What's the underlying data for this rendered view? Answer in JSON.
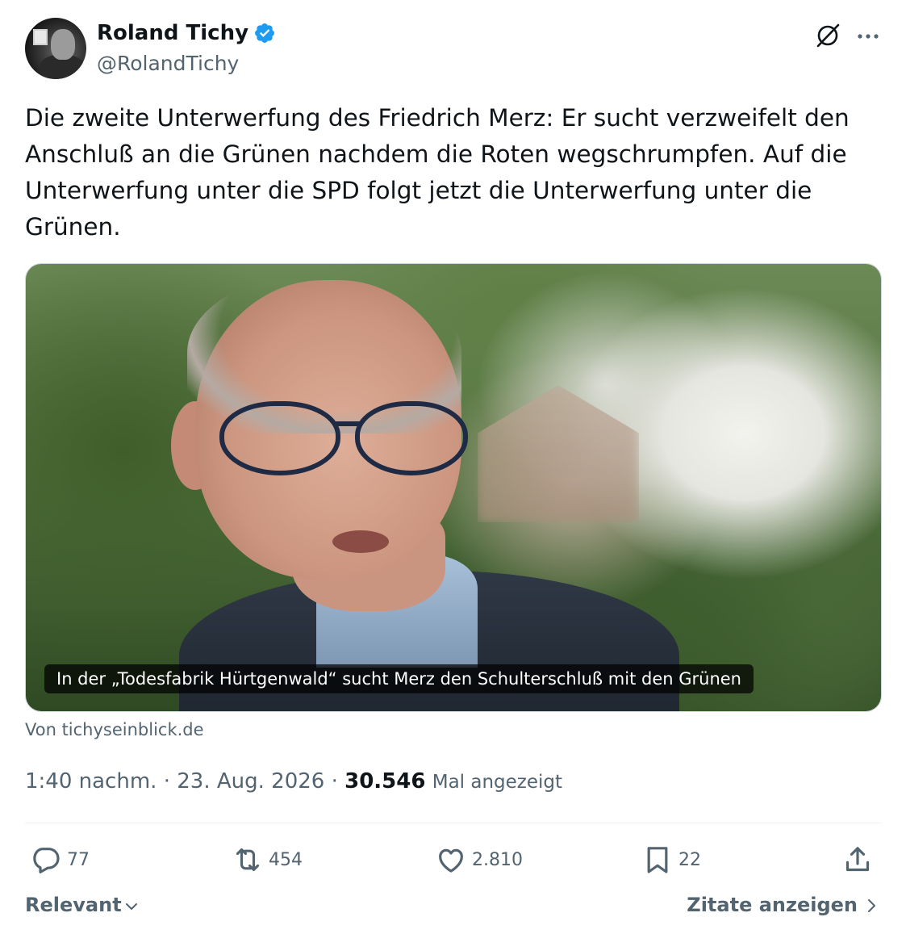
{
  "author": {
    "name": "Roland Tichy",
    "handle": "@RolandTichy",
    "verified": true
  },
  "tweet": {
    "text": "Die zweite Unterwerfung des Friedrich Merz: Er sucht verzweifelt den Anschluß an die Grünen nachdem die Roten wegschrumpfen. Auf die Unterwerfung unter die SPD folgt jetzt die Unterwerfung unter die Grünen."
  },
  "card": {
    "caption": "In der „Todesfabrik Hürtgenwald“ sucht Merz den Schulterschluß mit den Grünen",
    "source": "Von tichyseinblick.de"
  },
  "meta": {
    "time": "1:40 nachm.",
    "separator": "·",
    "date": "23. Aug. 2026",
    "views": "30.546",
    "views_label": "Mal angezeigt"
  },
  "actions": {
    "replies": "77",
    "retweets": "454",
    "likes": "2.810",
    "bookmarks": "22"
  },
  "footer": {
    "sort_label": "Relevant",
    "quotes_label": "Zitate anzeigen"
  },
  "colors": {
    "text_primary": "#0f1419",
    "text_secondary": "#536471",
    "verified_blue": "#1d9bf0",
    "divider": "#eff3f4"
  },
  "icons": [
    "grok-icon",
    "more-icon",
    "reply-icon",
    "retweet-icon",
    "like-icon",
    "bookmark-icon",
    "share-icon",
    "chevron-down-icon",
    "chevron-right-icon"
  ]
}
